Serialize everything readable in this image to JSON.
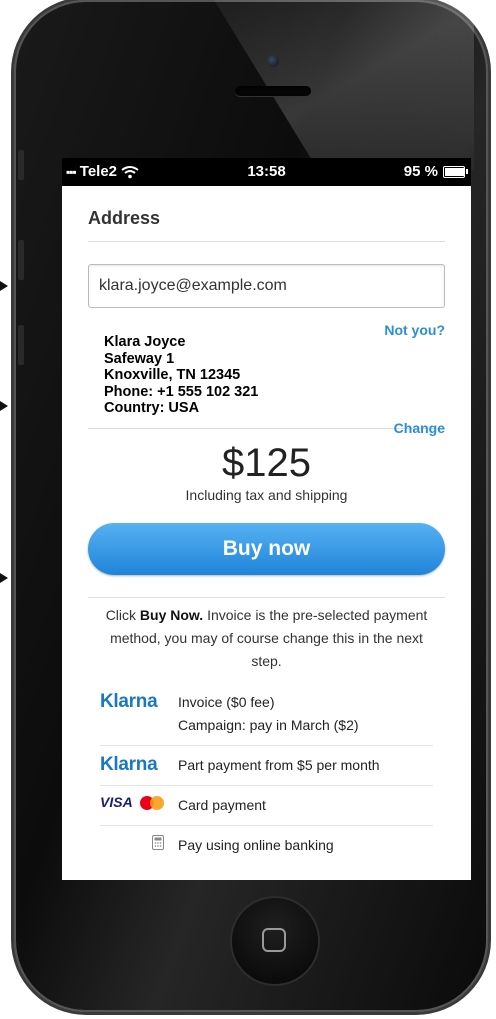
{
  "status_bar": {
    "carrier": "Tele2",
    "time": "13:58",
    "battery": "95 %",
    "battery_level": 0.95
  },
  "address": {
    "heading": "Address",
    "email": "klara.joyce@example.com",
    "name": "Klara Joyce",
    "street": "Safeway 1",
    "city": "Knoxville, TN 12345",
    "phone": "Phone: +1 555  102 321",
    "country": "Country: USA",
    "not_you": "Not you?",
    "change": "Change"
  },
  "order": {
    "price": "$125",
    "price_note": "Including tax and shipping",
    "buy_label": "Buy now"
  },
  "info": {
    "prefix": "Click ",
    "bold": "Buy Now.",
    "suffix": " Invoice is the pre-selected payment method, you may of course change this in the next step."
  },
  "payment_options": {
    "invoice": {
      "logo": "Klarna",
      "line1": "Invoice ($0 fee)",
      "line2": "Campaign: pay in March ($2)"
    },
    "part_payment": {
      "logo": "Klarna",
      "text": "Part payment from $5 per month"
    },
    "card": {
      "logo": "VISA",
      "text": "Card payment"
    },
    "bank": {
      "icon": "calculator-icon",
      "text": "Pay using online banking"
    }
  },
  "colors": {
    "accent": "#2b8ed6",
    "button": "#1f84d9",
    "klarna": "#1a78c2"
  }
}
